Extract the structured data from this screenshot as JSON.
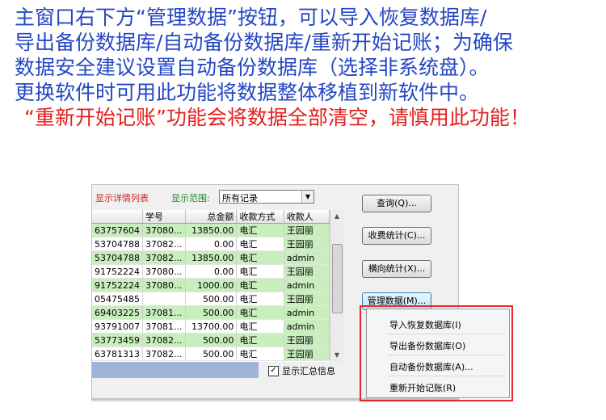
{
  "caption": {
    "line1": "主窗口右下方“管理数据”按钮，可以导入恢复数据库/",
    "line2": "导出备份数据库/自动备份数据库/重新开始记账；为确保",
    "line3": "数据安全建议设置自动备份数据库（选择非系统盘）。",
    "line4": "更换软件时可用此功能将数据整体移植到新软件中。",
    "line5": "“重新开始记账”功能会将数据全部清空，请慎用此功能！"
  },
  "colors": {
    "caption": "#2547c4",
    "warning": "#e3201c",
    "row_highlight": "#c9eebe",
    "menu_border": "#e32a2a"
  },
  "toolbar": {
    "detail_label": "显示详情列表",
    "range_label": "显示范围:",
    "range_value": "所有记录"
  },
  "table": {
    "columns": [
      "",
      "学号",
      "总金额",
      "收款方式",
      "收款人"
    ],
    "rows": [
      [
        "63757604",
        "37080...",
        "13850.00",
        "电汇",
        "王园丽"
      ],
      [
        "53704788",
        "37082...",
        "0.00",
        "电汇",
        "王园丽"
      ],
      [
        "53704788",
        "37082...",
        "13850.00",
        "电汇",
        "admin"
      ],
      [
        "91752224",
        "37080...",
        "0.00",
        "电汇",
        "王园丽"
      ],
      [
        "91752224",
        "37080...",
        "1000.00",
        "电汇",
        "admin"
      ],
      [
        "05475485",
        "",
        "500.00",
        "电汇",
        "王园丽"
      ],
      [
        "69403225",
        "37081...",
        "500.00",
        "电汇",
        "admin"
      ],
      [
        "93791007",
        "37081...",
        "13700.00",
        "电汇",
        "admin"
      ],
      [
        "53773459",
        "37082...",
        "500.00",
        "电汇",
        "王园丽"
      ],
      [
        "63781313",
        "37082...",
        "500.00",
        "电汇",
        "王园丽"
      ]
    ]
  },
  "summary_checkbox_label": "显示汇总信息",
  "buttons": {
    "query": "查询(Q)...",
    "fee_stats": "收费统计(C)...",
    "cross_stats": "横向统计(X)...",
    "manage_data": "管理数据(M)..."
  },
  "menu": {
    "items": [
      "导入恢复数据库(I)",
      "导出备份数据库(O)",
      "自动备份数据库(A)...",
      "重新开始记账(R)"
    ]
  }
}
